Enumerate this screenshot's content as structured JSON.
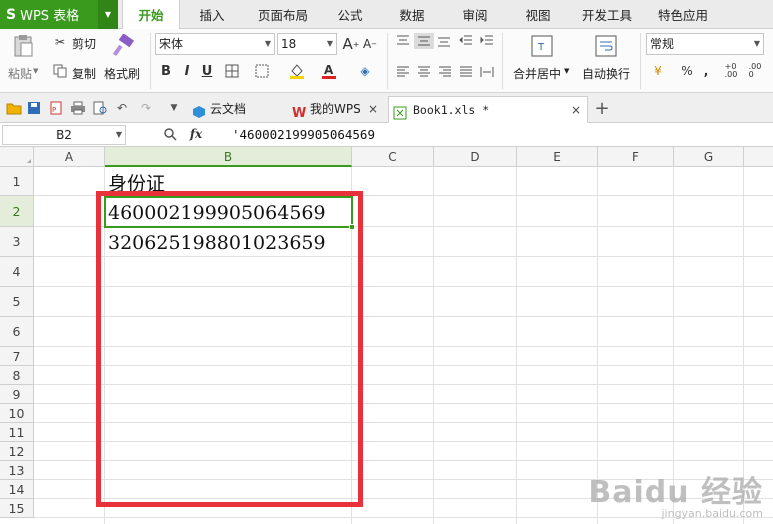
{
  "app": {
    "logo": "S",
    "title": "WPS 表格",
    "brand_color": "#3a9a1e"
  },
  "menu_tabs": [
    "开始",
    "插入",
    "页面布局",
    "公式",
    "数据",
    "审阅",
    "视图",
    "开发工具",
    "特色应用"
  ],
  "ribbon": {
    "paste_label": "粘贴",
    "cut_label": "剪切",
    "copy_label": "复制",
    "format_painter_label": "格式刷",
    "font_name": "宋体",
    "font_size": "18",
    "bold_label": "B",
    "italic_label": "I",
    "underline_label": "U",
    "merge_label": "合并居中",
    "wrap_label": "自动换行",
    "number_format": "常规",
    "percent_label": "%"
  },
  "doc_tabs": [
    {
      "label": "云文档",
      "icon": "cloud-icon"
    },
    {
      "label": "我的WPS",
      "icon": "wps-icon"
    },
    {
      "label": "Book1.xls *",
      "icon": "sheet-icon"
    }
  ],
  "formula_bar": {
    "name_box": "B2",
    "fx_label": "fx",
    "content": "'460002199905064569"
  },
  "columns": [
    "A",
    "B",
    "C",
    "D",
    "E",
    "F",
    "G"
  ],
  "rows": [
    "1",
    "2",
    "3",
    "4",
    "5",
    "6",
    "7",
    "8",
    "9",
    "10",
    "11",
    "12",
    "13",
    "14",
    "15"
  ],
  "cells": {
    "B1": "身份证",
    "B2": "460002199905064569",
    "B3": "320625198801023659"
  },
  "highlight_color": "#e8313a",
  "watermark": {
    "main": "Baidu 经验",
    "sub": "jingyan.baidu.com"
  }
}
